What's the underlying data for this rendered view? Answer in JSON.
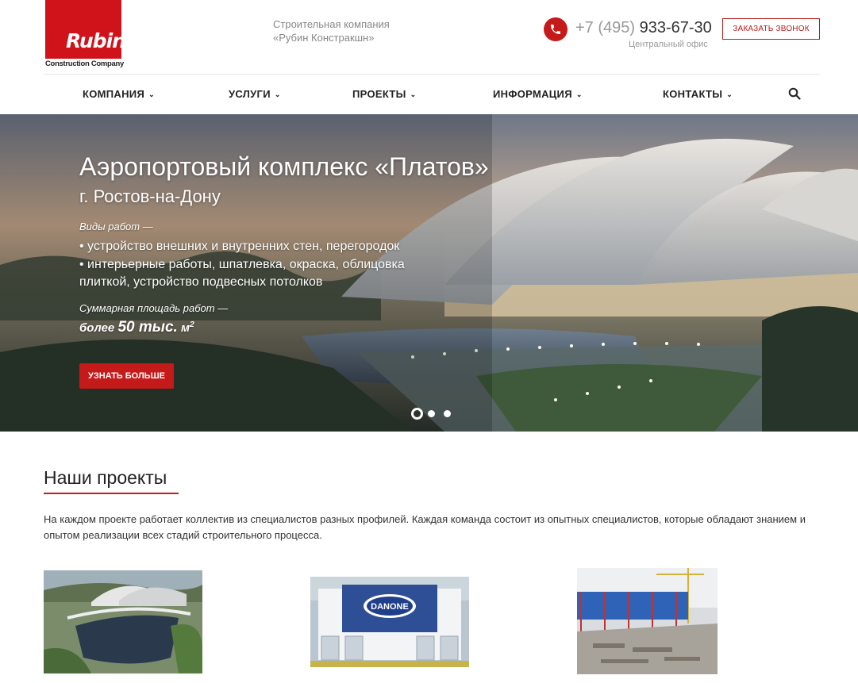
{
  "header": {
    "logo_word": "Rubin",
    "logo_sub": "Construction Company",
    "company_line1": "Строительная компания",
    "company_line2": "«Рубин Констракшн»",
    "phone_prefix": "+7 (495)",
    "phone_number": "933-67-30",
    "office_label": "Центральный офис",
    "call_button": "ЗАКАЗАТЬ ЗВОНОК"
  },
  "nav": {
    "items": [
      {
        "label": "КОМПАНИЯ"
      },
      {
        "label": "УСЛУГИ"
      },
      {
        "label": "ПРОЕКТЫ"
      },
      {
        "label": "ИНФОРМАЦИЯ"
      },
      {
        "label": "КОНТАКТЫ"
      }
    ],
    "caret": "⌄"
  },
  "hero": {
    "title": "Аэропортовый комплекс «Платов»",
    "city": "г. Ростов-на-Дону",
    "work_types_label": "Виды работ —",
    "bullet_1": "• устройство внешних и внутренних стен, перегородок",
    "bullet_2": "• интерьерные работы, шпатлевка, окраска, облицовка плиткой, устройство подвесных потолков",
    "area_label": "Суммарная площадь работ —",
    "area_prefix": "более",
    "area_value": "50 тыс.",
    "area_unit": "м",
    "area_sup": "2",
    "button": "УЗНАТЬ БОЛЬШЕ",
    "slides_total": 3,
    "active_slide": 1
  },
  "projects": {
    "title": "Наши проекты",
    "description": "На каждом проекте работает коллектив из специалистов разных профилей. Каждая команда состоит из опытных специалистов, которые обладают знанием и опытом реализации всех стадий строительного процесса.",
    "danone_logo_text": "DANONE"
  },
  "colors": {
    "brand_red": "#c41a1a",
    "text_dark": "#222222",
    "text_muted": "#888888"
  }
}
